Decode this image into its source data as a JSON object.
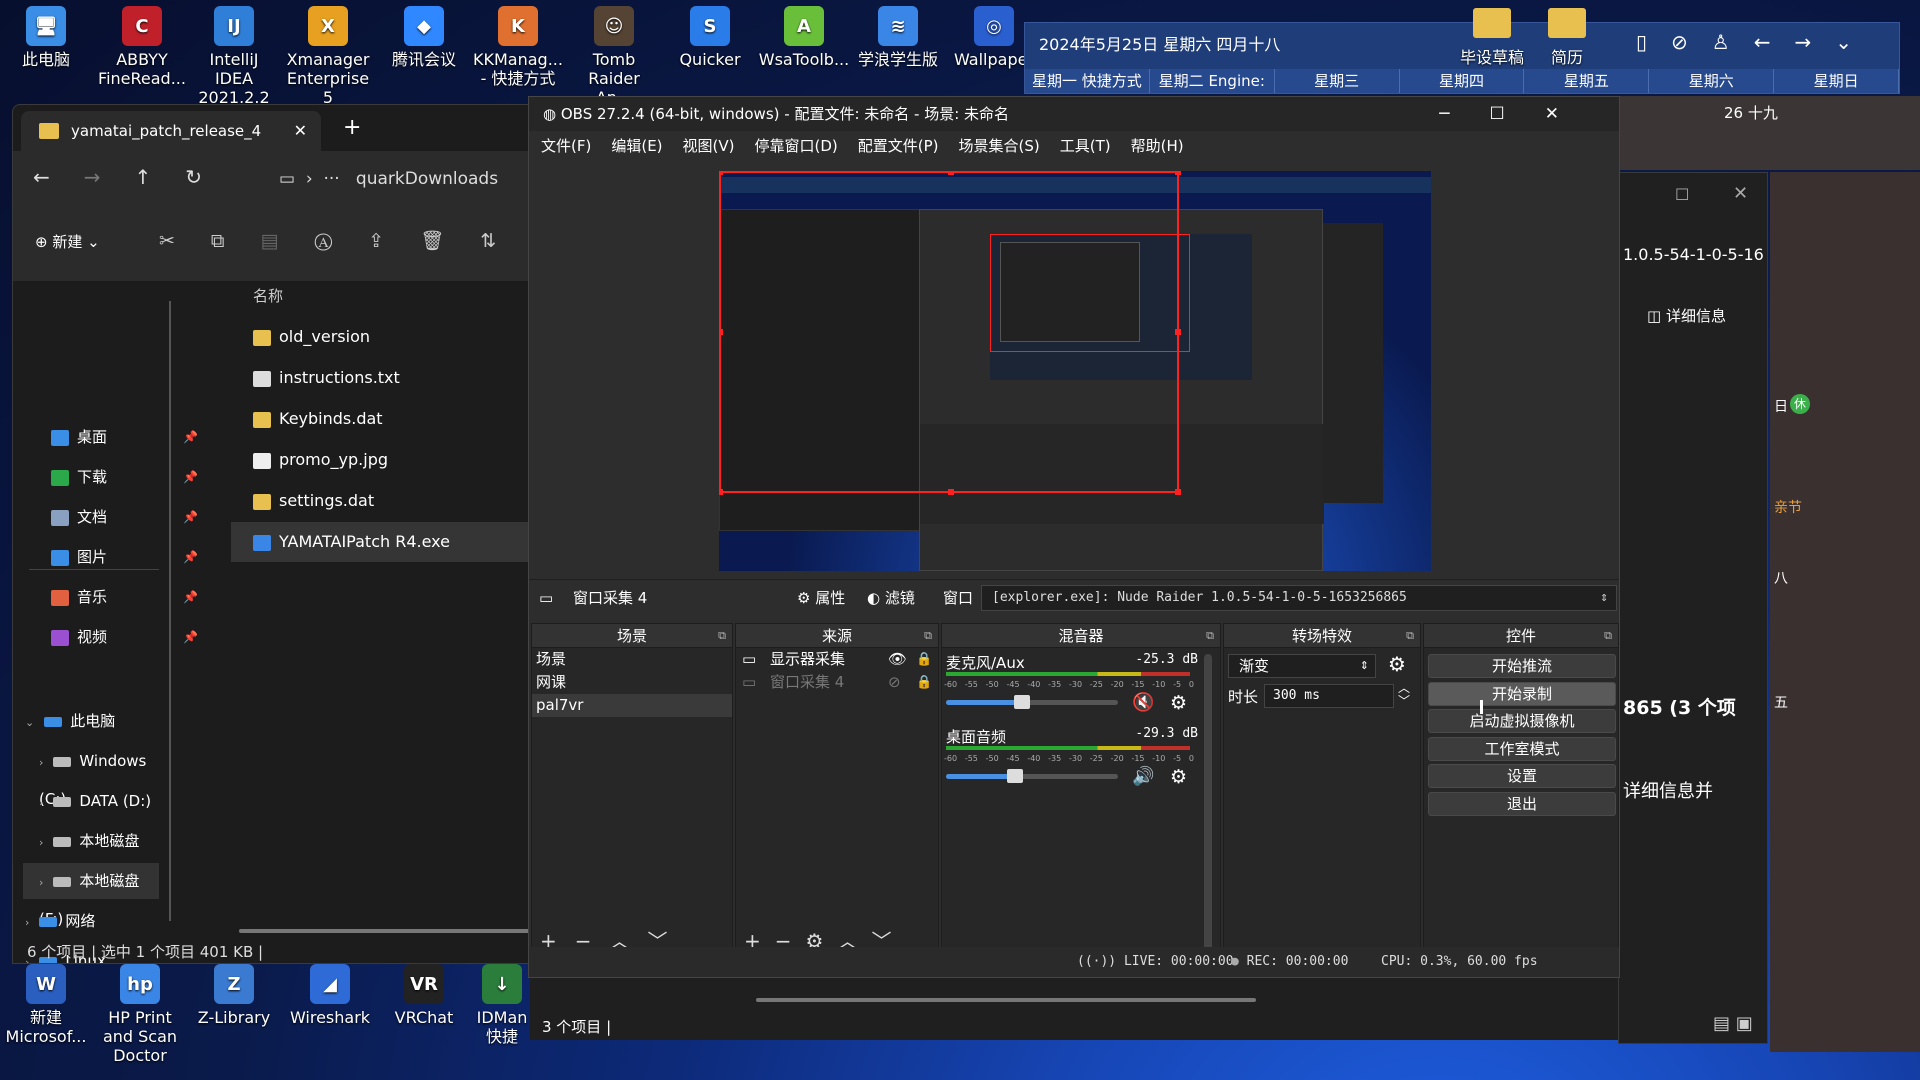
{
  "desktop": {
    "icons_top": [
      {
        "label": "此电脑",
        "color": "#3a8ee6",
        "glyph": "🖥"
      },
      {
        "label": "ABBYY FineRead...",
        "color": "#c0202a",
        "glyph": "C"
      },
      {
        "label": "IntelliJ IDEA 2021.2.2",
        "color": "#2f7fd8",
        "glyph": "IJ"
      },
      {
        "label": "Xmanager Enterprise 5",
        "color": "#e8a020",
        "glyph": "X"
      },
      {
        "label": "腾讯会议",
        "color": "#2f88ff",
        "glyph": "◆"
      },
      {
        "label": "KKManag... - 快捷方式",
        "color": "#e07030",
        "glyph": "K"
      },
      {
        "label": "Tomb Raider An...",
        "color": "#554433",
        "glyph": "☺"
      },
      {
        "label": "Quicker",
        "color": "#2a7de8",
        "glyph": "S"
      },
      {
        "label": "WsaToolb...",
        "color": "#6abf3a",
        "glyph": "A"
      },
      {
        "label": "学浪学生版",
        "color": "#3a86e6",
        "glyph": "≋"
      },
      {
        "label": "Wallpaper",
        "color": "#2a5fd0",
        "glyph": "◎"
      }
    ],
    "icons_right": [
      {
        "label": "毕设草稿",
        "color": "#e8c050"
      },
      {
        "label": "简历",
        "color": "#e8c050"
      }
    ],
    "icons_bottom": [
      {
        "label": "新建 Microsof...",
        "color": "#2b5fbf",
        "glyph": "W"
      },
      {
        "label": "HP Print and Scan Doctor",
        "color": "#3a86e6",
        "glyph": "hp"
      },
      {
        "label": "Z-Library",
        "color": "#3a7ad0",
        "glyph": "Z"
      },
      {
        "label": "Wireshark",
        "color": "#2e6bd6",
        "glyph": "◢"
      },
      {
        "label": "VRChat",
        "color": "#222",
        "glyph": "VR"
      },
      {
        "label": "IDMan 快捷",
        "color": "#2a7d3a",
        "glyph": "↓"
      }
    ]
  },
  "calendar": {
    "date": "2024年5月25日 星期六 四月十八",
    "days": [
      "星期一 快捷方式",
      "星期二 Engine: ...",
      "星期三",
      "星期四",
      "星期五",
      "星期六",
      "星期日"
    ],
    "corner": "26 十九"
  },
  "explorer": {
    "tab_title": "yamatai_patch_release_4",
    "address": "quarkDownloads",
    "new_label": "新建",
    "column_name": "名称",
    "sidebar_quick": [
      {
        "label": "桌面",
        "color": "#3a8ee6"
      },
      {
        "label": "下载",
        "color": "#2aa84a"
      },
      {
        "label": "文档",
        "color": "#8aa0c0"
      },
      {
        "label": "图片",
        "color": "#3a8ee6"
      },
      {
        "label": "音乐",
        "color": "#e06040"
      },
      {
        "label": "视频",
        "color": "#9a50d0"
      }
    ],
    "sidebar_tree": [
      {
        "label": "此电脑",
        "indent": 0,
        "expanded": true
      },
      {
        "label": "Windows (C:)",
        "indent": 1
      },
      {
        "label": "DATA (D:)",
        "indent": 1
      },
      {
        "label": "本地磁盘 (E:)",
        "indent": 1
      },
      {
        "label": "本地磁盘 (F:)",
        "indent": 1,
        "selected": true
      },
      {
        "label": "网络",
        "indent": 0
      },
      {
        "label": "Linux",
        "indent": 0
      }
    ],
    "files": [
      {
        "name": "old_version",
        "type": "folder"
      },
      {
        "name": "instructions.txt",
        "type": "txt"
      },
      {
        "name": "Keybinds.dat",
        "type": "dat"
      },
      {
        "name": "promo_yp.jpg",
        "type": "img"
      },
      {
        "name": "settings.dat",
        "type": "dat"
      },
      {
        "name": "YAMATAIPatch R4.exe",
        "type": "exe",
        "selected": true
      }
    ],
    "status": "6 个项目 | 选中 1 个项目 401 KB |"
  },
  "obs": {
    "title": "OBS 27.2.4 (64-bit, windows) - 配置文件: 未命名 - 场景: 未命名",
    "menu": [
      "文件(F)",
      "编辑(E)",
      "视图(V)",
      "停靠窗口(D)",
      "配置文件(P)",
      "场景集合(S)",
      "工具(T)",
      "帮助(H)"
    ],
    "context_bar": {
      "source": "窗口采集 4",
      "properties": "属性",
      "filters": "滤镜",
      "window_label": "窗口",
      "window_value": "[explorer.exe]: Nude Raider 1.0.5-54-1-0-5-1653256865"
    },
    "docks": {
      "scenes": {
        "title": "场景",
        "items": [
          "场景",
          "网课",
          "pal7vr"
        ]
      },
      "sources": {
        "title": "来源",
        "items": [
          {
            "name": "显示器采集",
            "visible": true
          },
          {
            "name": "窗口采集 4",
            "visible": false
          }
        ]
      },
      "mixer": {
        "title": "混音器",
        "channels": [
          {
            "name": "麦克风/Aux",
            "db": "-25.3 dB",
            "muted": true,
            "fader": 0.44
          },
          {
            "name": "桌面音频",
            "db": "-29.3 dB",
            "muted": false,
            "fader": 0.4
          }
        ],
        "ticks": [
          "-60",
          "-55",
          "-50",
          "-45",
          "-40",
          "-35",
          "-30",
          "-25",
          "-20",
          "-15",
          "-10",
          "-5",
          "0"
        ]
      },
      "transitions": {
        "title": "转场特效",
        "type": "渐变",
        "duration_label": "时长",
        "duration": "300 ms"
      },
      "controls": {
        "title": "控件",
        "buttons": [
          "开始推流",
          "开始录制",
          "启动虚拟摄像机",
          "工作室模式",
          "设置",
          "退出"
        ]
      }
    },
    "status": {
      "live": "LIVE: 00:00:00",
      "rec": "REC: 00:00:00",
      "cpu": "CPU: 0.3%, 60.00 fps"
    }
  },
  "right_window": {
    "text_version": "1.0.5-54-1-0-5-16",
    "details": "详细信息",
    "count": "865 (3 个项",
    "details2": "详细信息并",
    "status": "3 个项目 |",
    "frag_1": "亲节",
    "frag_2": "八",
    "frag_3": "五",
    "frag_4": "休",
    "frag_5": "日"
  },
  "colors": {
    "accent": "#3a8ee6",
    "selection": "#404040",
    "obs_bg": "#2d2d2d",
    "red_bbox": "#ff2020"
  }
}
